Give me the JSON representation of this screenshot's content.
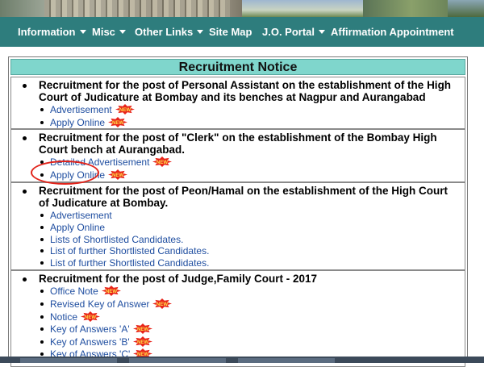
{
  "nav": {
    "items": [
      {
        "label": "Information",
        "has_caret": true
      },
      {
        "label": "Misc",
        "has_caret": true
      },
      {
        "label": "Other Links",
        "has_caret": true
      },
      {
        "label": "Site Map",
        "has_caret": false
      },
      {
        "label": "J.O. Portal",
        "has_caret": true
      },
      {
        "label": "Affirmation Appointment",
        "has_caret": false
      }
    ]
  },
  "notice": {
    "title": "Recruitment Notice",
    "sections": [
      {
        "heading": "Recruitment for the post of Personal Assistant on the establishment of the High Court of Judicature at Bombay and its benches at Nagpur and Aurangabad",
        "links": [
          {
            "label": "Advertisement",
            "is_new": true
          },
          {
            "label": "Apply Online",
            "is_new": true
          }
        ]
      },
      {
        "heading": "Recruitment for the post of \"Clerk\" on the establishment of the Bombay High Court bench at Aurangabad.",
        "links": [
          {
            "label": "Detailed Advertisement",
            "is_new": true
          },
          {
            "label": "Apply Online",
            "is_new": true,
            "highlighted": true
          }
        ]
      },
      {
        "heading": "Recruitment for the post of Peon/Hamal on the establishment of the High Court of Judicature at Bombay.",
        "links": [
          {
            "label": "Advertisement",
            "is_new": false
          },
          {
            "label": "Apply Online",
            "is_new": false
          },
          {
            "label": "Lists of Shortlisted Candidates.",
            "is_new": false
          },
          {
            "label": "List of further Shortlisted Candidates.",
            "is_new": false
          },
          {
            "label": "List of further Shortlisted Candidates.",
            "is_new": false
          }
        ]
      },
      {
        "heading": "Recruitment for the post of Judge,Family Court - 2017",
        "links": [
          {
            "label": "Office Note",
            "is_new": true
          },
          {
            "label": "Revised Key of Answer",
            "is_new": true
          },
          {
            "label": "Notice",
            "is_new": true
          },
          {
            "label": "Key of Answers 'A'",
            "is_new": true
          },
          {
            "label": "Key of Answers 'B'",
            "is_new": true
          },
          {
            "label": "Key of Answers 'C'",
            "is_new": true
          }
        ]
      }
    ],
    "new_badge_text": "NEW"
  },
  "colors": {
    "nav_bg": "#2e7d7d",
    "title_bg": "#7fd6cc",
    "link": "#1f4ea0",
    "highlight_circle": "#e2231a",
    "badge_fill": "#e8231a",
    "badge_text": "#ffe14a"
  }
}
